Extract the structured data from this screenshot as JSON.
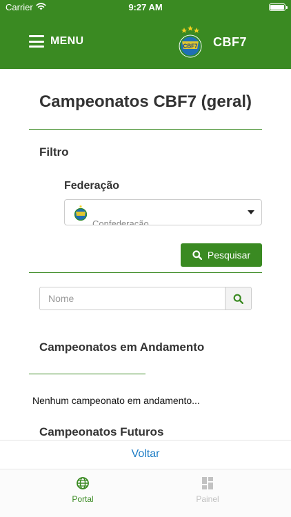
{
  "status_bar": {
    "carrier": "Carrier",
    "time": "9:27 AM"
  },
  "header": {
    "menu_label": "MENU",
    "brand_name": "CBF7",
    "logo_text": "CBF7"
  },
  "page": {
    "title": "Campeonatos CBF7 (geral)"
  },
  "filter": {
    "heading": "Filtro",
    "federation_label": "Federação",
    "federation_value": "Confederação",
    "search_button_label": "Pesquisar"
  },
  "name_search": {
    "placeholder": "Nome"
  },
  "sections": {
    "ongoing_heading": "Campeonatos em Andamento",
    "ongoing_empty": "Nenhum campeonato em andamento...",
    "future_heading": "Campeonatos Futuros"
  },
  "footer": {
    "back_label": "Voltar"
  },
  "tabbar": {
    "tabs": [
      {
        "label": "Portal",
        "icon": "globe-icon",
        "active": true
      },
      {
        "label": "Painel",
        "icon": "dashboard-icon",
        "active": false
      }
    ]
  },
  "colors": {
    "primary_green": "#3a8a22",
    "link_blue": "#1a7bc4",
    "inactive_gray": "#c2c2c2"
  }
}
